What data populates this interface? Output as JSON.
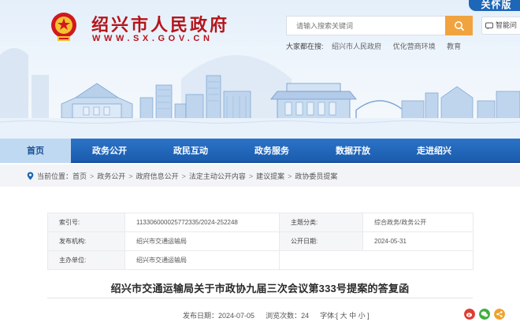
{
  "site": {
    "name": "绍兴市人民政府",
    "domain": "WWW.SX.GOV.CN",
    "elder_mode": "关怀版"
  },
  "search": {
    "placeholder": "请输入搜索关键词",
    "smart_label": "智能问"
  },
  "hot_words": {
    "label": "大家都在搜:",
    "items": [
      "绍兴市人民政府",
      "优化营商环境",
      "教育"
    ]
  },
  "nav": {
    "items": [
      {
        "label": "首页",
        "active": true
      },
      {
        "label": "政务公开",
        "active": false
      },
      {
        "label": "政民互动",
        "active": false
      },
      {
        "label": "政务服务",
        "active": false
      },
      {
        "label": "数据开放",
        "active": false
      },
      {
        "label": "走进绍兴",
        "active": false
      }
    ]
  },
  "breadcrumb": {
    "items": [
      "当前位置：首页",
      "政务公开",
      "政府信息公开",
      "法定主动公开内容",
      "建议提案",
      "政协委员提案"
    ]
  },
  "info": {
    "index_label": "索引号:",
    "index_value": "113306000025772335/2024-252248",
    "topic_label": "主题分类:",
    "topic_value": "综合政务/政务公开",
    "org_label": "发布机构:",
    "org_value": "绍兴市交通运输局",
    "date_label": "公开日期:",
    "date_value": "2024-05-31",
    "owner_label": "主办单位:",
    "owner_value": "绍兴市交通运输局"
  },
  "article": {
    "title": "绍兴市交通运输局关于市政协九届三次会议第333号提案的答复函",
    "publish_label": "发布日期：",
    "publish_date": "2024-07-05",
    "views_label": "浏览次数：",
    "views": "24",
    "font_label": "字体:",
    "font_sizes": "[ 大 中 小 ]"
  },
  "colors": {
    "brand_red": "#b4151b",
    "nav_blue": "#1b5cae",
    "search_orange": "#f1a33f"
  }
}
